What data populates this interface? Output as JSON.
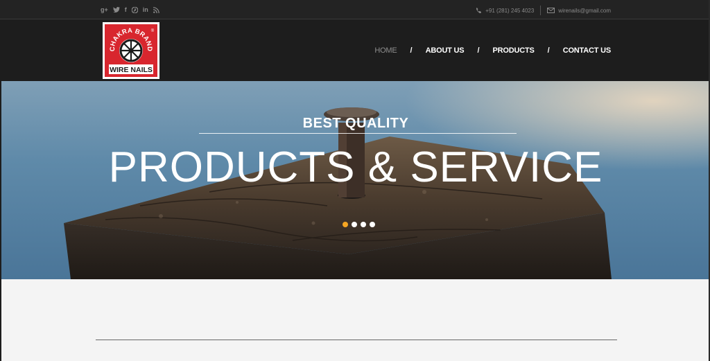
{
  "topbar": {
    "social_icons": [
      "google-plus-icon",
      "twitter-icon",
      "facebook-icon",
      "pinterest-icon",
      "linkedin-icon",
      "rss-icon"
    ],
    "phone": "+91 (281) 245 4023",
    "email": "wirenails@gmail.com"
  },
  "logo": {
    "top_text": "CHAKRA BRAND",
    "bottom_text": "WIRE NAILS",
    "mark": "®"
  },
  "nav": {
    "items": [
      {
        "label": "HOME",
        "active": true
      },
      {
        "label": "ABOUT US",
        "active": false
      },
      {
        "label": "PRODUCTS",
        "active": false
      },
      {
        "label": "CONTACT US",
        "active": false
      }
    ],
    "separator": "/"
  },
  "hero": {
    "subtitle": "BEST QUALITY",
    "title": "PRODUCTS & SERVICE",
    "slides_count": 4,
    "active_slide": 1,
    "accent_color": "#f5a623"
  },
  "colors": {
    "header_bg": "#1d1d1d",
    "topbar_bg": "#232323",
    "logo_red": "#d8262e",
    "lower_bg": "#f4f4f4"
  }
}
